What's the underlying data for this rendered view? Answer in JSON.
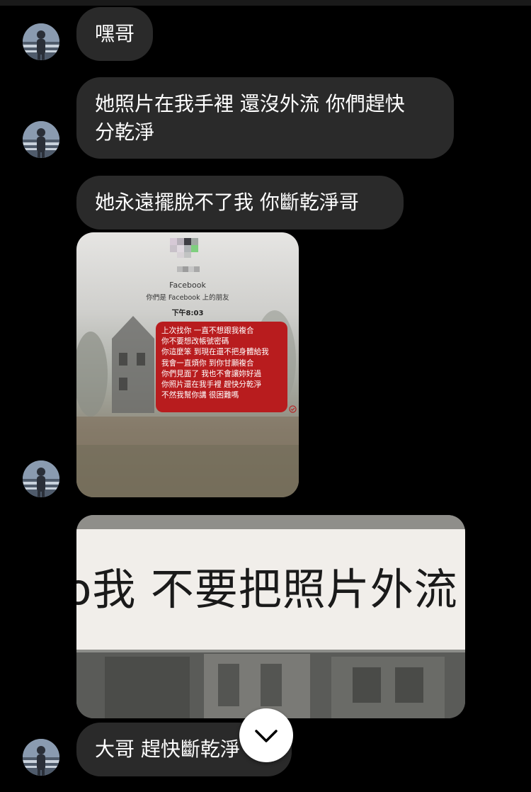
{
  "messages": [
    {
      "text": "嘿哥"
    },
    {
      "text": "她照片在我手裡 還沒外流 你們趕快\n分乾淨"
    },
    {
      "text": "她永遠擺脫不了我 你斷乾淨哥"
    },
    {
      "text": "大哥 趕快斷乾淨"
    }
  ],
  "screenshot1": {
    "name": "Facebook",
    "subtitle": "你們是 Facebook 上的朋友",
    "time": "下午8:03",
    "message_lines": [
      "上次找你 一直不想跟我複合",
      "你不要想改帳號密碼",
      "你這麼笨 到現在還不把身體給我",
      "我會一直煩你 到你甘願複合",
      "你們見面了 我也不會讓妳好過",
      "你照片還在我手裡 趕快分乾淨",
      "不然我幫你講 很困難嗎"
    ]
  },
  "screenshot2": {
    "caption": "o我 不要把照片外流"
  },
  "colors": {
    "background": "#000000",
    "bubble": "#2a2a2a",
    "red_message": "#b81c1e"
  },
  "icons": {
    "scroll_down": "chevron-down-icon",
    "avatar": "avatar"
  }
}
